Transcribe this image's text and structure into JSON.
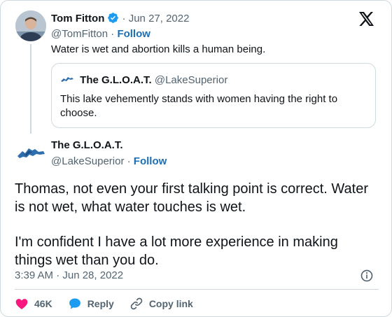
{
  "parent_tweet": {
    "author_name": "Tom Fitton",
    "separator": "·",
    "date": "Jun 27, 2022",
    "handle": "@TomFitton",
    "follow_label": "Follow",
    "text": "Water is wet and abortion kills a human being.",
    "verified_color": "#1d9bf0"
  },
  "quoted_tweet": {
    "author_name": "The G.L.O.A.T.",
    "handle": "@LakeSuperior",
    "text": "This lake vehemently stands with women having the right to choose."
  },
  "main_tweet": {
    "author_name": "The G.L.O.A.T.",
    "handle": "@LakeSuperior",
    "separator": "·",
    "follow_label": "Follow",
    "paragraph_1": "Thomas, not even your first talking point is correct. Water is not wet, what water touches is wet.",
    "paragraph_2": "I'm confident I have a lot more experience in making things wet than you do.",
    "timestamp": "3:39 AM · Jun 28, 2022"
  },
  "actions": {
    "like_count": "46K",
    "reply_label": "Reply",
    "copy_link_label": "Copy link"
  },
  "colors": {
    "text": "#0f1419",
    "muted": "#536471",
    "link": "#1d9bf0",
    "like": "#f91880",
    "border": "#cfd9de"
  }
}
